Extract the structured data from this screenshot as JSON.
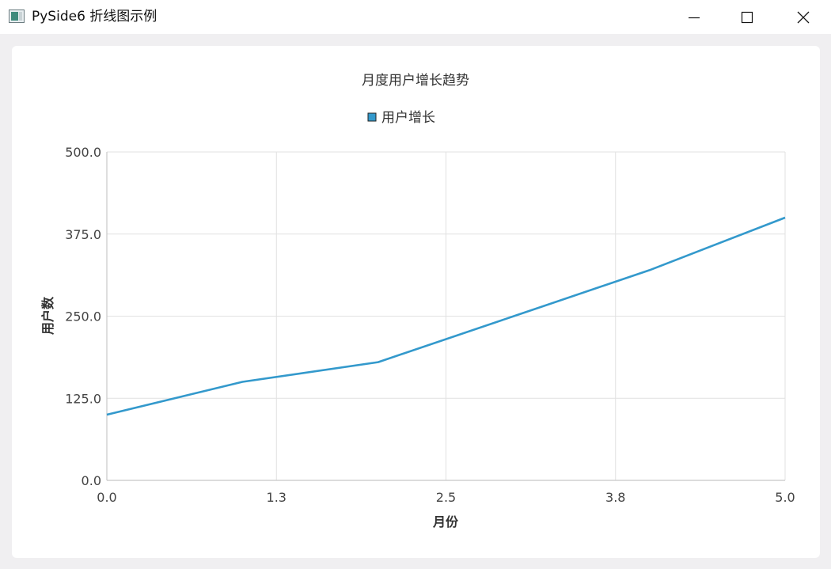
{
  "window": {
    "title": "PySide6 折线图示例",
    "icons": {
      "app": "app-window-icon",
      "minimize": "minimize-icon",
      "maximize": "maximize-icon",
      "close": "close-icon"
    }
  },
  "chart_data": {
    "type": "line",
    "title": "月度用户增长趋势",
    "xlabel": "月份",
    "ylabel": "用户数",
    "xlim": [
      0,
      5
    ],
    "ylim": [
      0,
      500
    ],
    "x_ticks": [
      "0.0",
      "1.3",
      "2.5",
      "3.8",
      "5.0"
    ],
    "y_ticks": [
      "0.0",
      "125.0",
      "250.0",
      "375.0",
      "500.0"
    ],
    "grid": true,
    "legend": "top-center",
    "series": [
      {
        "name": "用户增长",
        "color": "#3399cc",
        "x": [
          0,
          1,
          2,
          3,
          4,
          5
        ],
        "values": [
          100,
          150,
          180,
          250,
          320,
          400
        ]
      }
    ]
  }
}
